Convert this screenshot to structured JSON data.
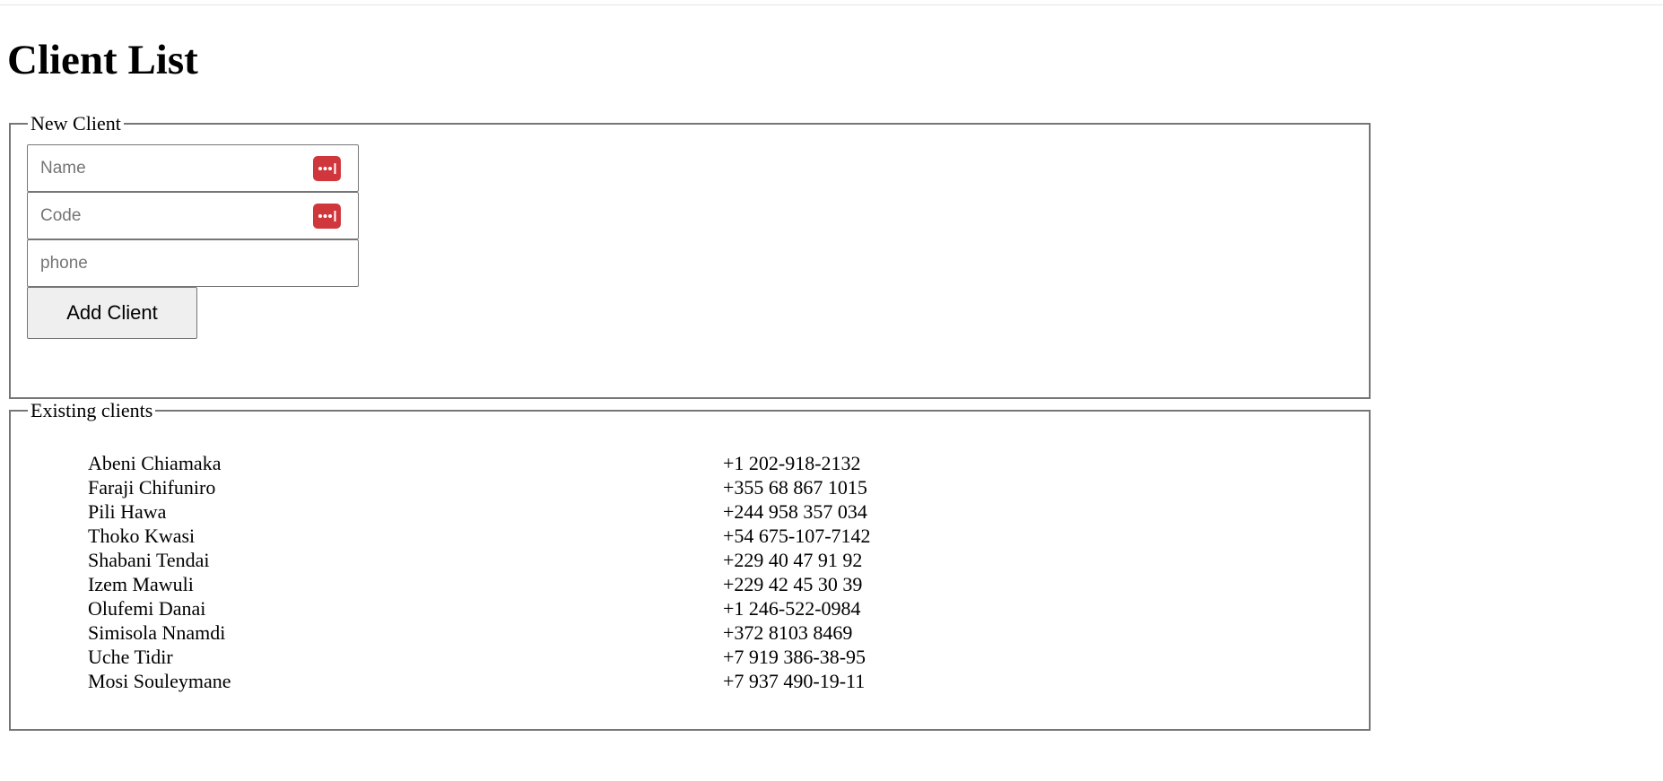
{
  "page": {
    "title": "Client List"
  },
  "new_client": {
    "legend": "New Client",
    "name_placeholder": "Name",
    "code_placeholder": "Code",
    "phone_placeholder": "phone",
    "name_value": "",
    "code_value": "",
    "phone_value": "",
    "add_button_label": "Add Client",
    "password_manager_icon": "password-manager-icon",
    "icon_color": "#d0373c"
  },
  "existing": {
    "legend": "Existing clients",
    "clients": [
      {
        "name": "Abeni Chiamaka",
        "phone": "+1 202-918-2132"
      },
      {
        "name": "Faraji Chifuniro",
        "phone": "+355 68 867 1015"
      },
      {
        "name": "Pili Hawa",
        "phone": "+244 958 357 034"
      },
      {
        "name": "Thoko Kwasi",
        "phone": "+54 675-107-7142"
      },
      {
        "name": "Shabani Tendai",
        "phone": "+229 40 47 91 92"
      },
      {
        "name": "Izem Mawuli",
        "phone": "+229 42 45 30 39"
      },
      {
        "name": "Olufemi Danai",
        "phone": "+1 246-522-0984"
      },
      {
        "name": "Simisola Nnamdi",
        "phone": "+372 8103 8469"
      },
      {
        "name": "Uche Tidir",
        "phone": "+7 919 386-38-95"
      },
      {
        "name": "Mosi Souleymane",
        "phone": "+7 937 490-19-11"
      }
    ]
  }
}
